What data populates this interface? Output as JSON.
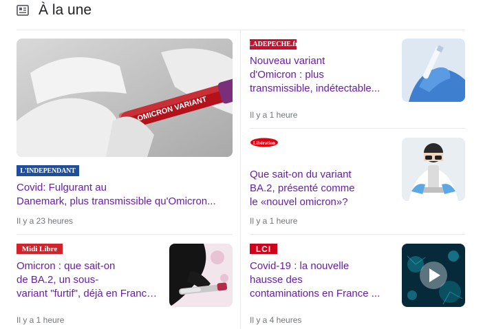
{
  "section": {
    "title": "À la une"
  },
  "articles": [
    {
      "source": "L'INDEPENDANT",
      "headline_lines": [
        "Covid: Fulgurant au",
        "Danemark, plus transmissible qu'Omicron..."
      ],
      "time": "Il y a 23 heures",
      "image_label": "OMICRON VARIANT"
    },
    {
      "source": "LADEPECHE.fr",
      "headline_lines": [
        "Nouveau variant",
        "d'Omicron : plus",
        "transmissible, indétectable..."
      ],
      "time": "Il y a 1 heure"
    },
    {
      "source": "Libération",
      "headline_lines": [
        "Que sait-on du variant",
        "BA.2, présenté comme",
        "le «nouvel omicron»?"
      ],
      "time": "Il y a 1 heure"
    },
    {
      "source": "Midi Libre",
      "headline_lines": [
        "Omicron : que sait-on",
        "de BA.2, un sous-",
        "variant \"furtif\", déjà en France..."
      ],
      "time": "Il y a 1 heure"
    },
    {
      "source": "LCI",
      "headline_lines": [
        "Covid-19 : la nouvelle",
        "hausse des",
        "contaminations en France ..."
      ],
      "time": "Il y a 4 heures"
    }
  ],
  "colors": {
    "headline": "#681da8",
    "time": "#70757a",
    "independant": "#1f4e9a",
    "depeche": "#c8102e",
    "midilibre": "#d2232a",
    "lci": "#d0021b"
  }
}
